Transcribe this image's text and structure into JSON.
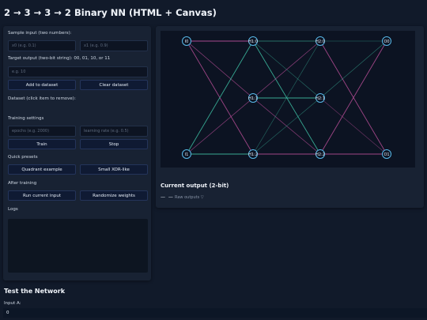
{
  "header": {
    "title": "2 → 3 → 3 → 2 Binary NN (HTML + Canvas)"
  },
  "controls": {
    "sample_input_label": "Sample input (two numbers):",
    "x0_placeholder": "x0 (e.g. 0.1)",
    "x1_placeholder": "x1 (e.g. 0.9)",
    "target_label": "Target output (two-bit string): 00, 01, 10, or 11",
    "target_placeholder": "e.g. 10",
    "add_button": "Add to dataset",
    "clear_button": "Clear dataset",
    "dataset_label": "Dataset (click item to remove):",
    "training_label": "Training settings",
    "epochs_placeholder": "epochs (e.g. 2000)",
    "lr_placeholder": "learning rate (e.g. 0.5)",
    "train_button": "Train",
    "stop_button": "Stop",
    "presets_label": "Quick presets",
    "quadrant_button": "Quadrant example",
    "xor_button": "Small XOR-like",
    "after_label": "After training",
    "run_button": "Run current input",
    "randomize_button": "Randomize weights",
    "logs_label": "Logs"
  },
  "network": {
    "nodes": {
      "i0": "I0",
      "i1": "I1",
      "h1_0": "H1:0",
      "h1_1": "H1:1",
      "h1_2": "H1:2",
      "h2_0": "H2:0",
      "h2_1": "H2:1",
      "h2_2": "H2:2",
      "o0": "O0",
      "o1": "O1"
    }
  },
  "output": {
    "title": "Current output (2-bit)",
    "value": "— —",
    "raw_toggle": "Raw outputs ▽"
  },
  "test": {
    "title": "Test the Network",
    "input_a_label": "Input A:",
    "input_a_value": "0"
  },
  "colors": {
    "positive_edge": "#3fc3a6",
    "negative_edge": "#c452a0",
    "node_stroke": "#58b8e8"
  }
}
